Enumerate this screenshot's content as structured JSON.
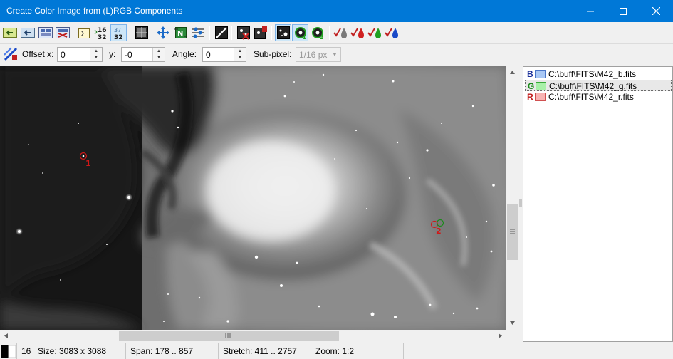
{
  "window": {
    "title": "Create Color Image from (L)RGB Components"
  },
  "toolbar": {
    "buttons": [
      "load-image-left",
      "load-image-back",
      "image-list",
      "image-list-remove",
      "sum-rgb",
      "bit-16-32",
      "bit-32",
      "screen-stretch",
      "move-align",
      "auto-align-dn",
      "align-settings",
      "diagonal-tool",
      "delete-star",
      "auto-stars",
      "star-select",
      "star-match-1",
      "star-match-2",
      "check-gray",
      "check-red",
      "check-green",
      "check-blue"
    ]
  },
  "options": {
    "offset_x_label": "Offset x:",
    "offset_x_value": "0",
    "y_label": "y:",
    "y_value": "-0",
    "angle_label": "Angle:",
    "angle_value": "0",
    "subpixel_label": "Sub-pixel:",
    "subpixel_value": "1/16 px"
  },
  "markers": {
    "marker1_label": "1",
    "marker2_label": "2"
  },
  "channels": [
    {
      "letter": "B",
      "path": "C:\\buff\\FITS\\M42_b.fits",
      "letter_color": "#1a2f9a",
      "swatch_fill": "#a9c8f5",
      "swatch_border": "#4a76c8",
      "selected": false
    },
    {
      "letter": "G",
      "path": "C:\\buff\\FITS\\M42_g.fits",
      "letter_color": "#1a8a1a",
      "swatch_fill": "#a8f0a8",
      "swatch_border": "#3aa83a",
      "selected": true
    },
    {
      "letter": "R",
      "path": "C:\\buff\\FITS\\M42_r.fits",
      "letter_color": "#c01818",
      "swatch_fill": "#f8b4b4",
      "swatch_border": "#d05050",
      "selected": false
    }
  ],
  "status": {
    "bits": "16",
    "size": "Size: 3083 x 3088",
    "span": "Span: 178 .. 857",
    "stretch": "Stretch: 411 .. 2757",
    "zoom": "Zoom: 1:2"
  },
  "colors": {
    "titlebar": "#0078d7",
    "accent": "#0078d7"
  }
}
